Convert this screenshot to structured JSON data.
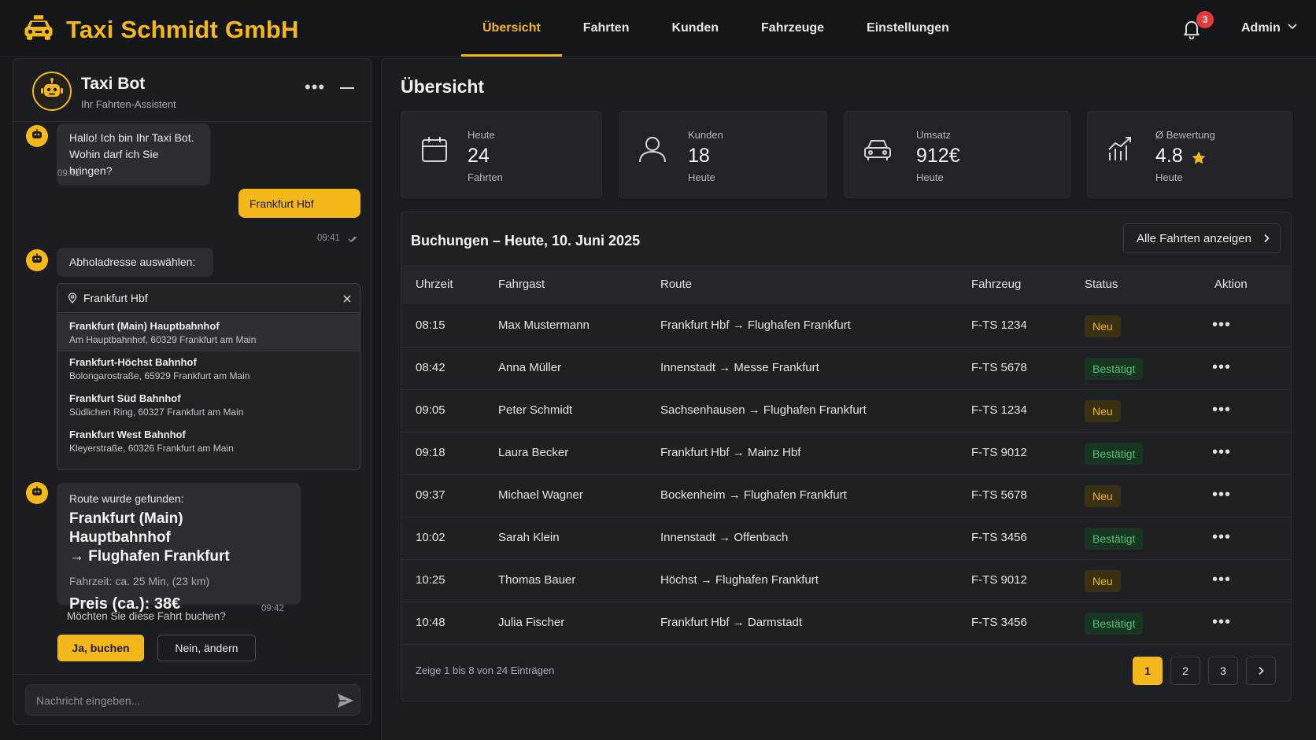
{
  "brand": {
    "name": "Taxi Schmidt GmbH",
    "accent_color": "#f5b81a"
  },
  "nav": {
    "items": [
      {
        "label": "Übersicht",
        "active": true
      },
      {
        "label": "Fahrten",
        "active": false
      },
      {
        "label": "Kunden",
        "active": false
      },
      {
        "label": "Fahrzeuge",
        "active": false
      },
      {
        "label": "Einstellungen",
        "active": false
      }
    ]
  },
  "header": {
    "notifications_count": "3",
    "user_label": "Admin"
  },
  "chat": {
    "title": "Taxi Bot",
    "subtitle": "Ihr Fahrten-Assistent",
    "messages": {
      "greeting_line1": "Hallo! Ich bin Ihr Taxi Bot.",
      "greeting_line2": "Wohin darf ich Sie bringen?",
      "greeting_time": "09:41",
      "user_msg": "Frankfurt Hbf",
      "user_time": "09:41",
      "pickup_prompt": "Abholadresse auswählen:"
    },
    "address_search": {
      "value": "Frankfurt Hbf",
      "options": [
        {
          "title": "Frankfurt (Main) Hauptbahnhof",
          "subtitle": "Am Hauptbahnhof, 60329 Frankfurt am Main",
          "selected": true
        },
        {
          "title": "Frankfurt-Höchst Bahnhof",
          "subtitle": "Bolongarostraße, 65929 Frankfurt am Main",
          "selected": false
        },
        {
          "title": "Frankfurt Süd Bahnhof",
          "subtitle": "Südlichen Ring, 60327 Frankfurt am Main",
          "selected": false
        },
        {
          "title": "Frankfurt West Bahnhof",
          "subtitle": "Kleyerstraße, 60326 Frankfurt am Main",
          "selected": false
        }
      ]
    },
    "route": {
      "label": "Route wurde gefunden:",
      "line1": "Frankfurt (Main) Hauptbahnhof",
      "line2": "→ Flughafen Frankfurt",
      "duration": "Fahrzeit: ca. 25 Min, (23 km)",
      "price": "Preis (ca.):  38€",
      "time": "09:42"
    },
    "question": "Möchten Sie diese Fahrt buchen?",
    "yes_label": "Ja, buchen",
    "no_label": "Nein, ändern",
    "input_placeholder": "Nachricht eingeben..."
  },
  "overview": {
    "title": "Übersicht",
    "kpis": [
      {
        "label": "Heute",
        "value": "24",
        "sub": "Fahrten",
        "icon": "calendar-icon"
      },
      {
        "label": "Kunden",
        "value": "18",
        "sub": "Heute",
        "icon": "user-icon"
      },
      {
        "label": "Umsatz",
        "value": "912€",
        "sub": "Heute",
        "icon": "car-icon"
      },
      {
        "label": "Ø Bewertung",
        "value": "4.8",
        "sub": "Heute",
        "icon": "chart-icon"
      }
    ]
  },
  "bookings": {
    "title": "Buchungen – Heute, 10. Juni 2025",
    "all_button": "Alle Fahrten anzeigen",
    "columns": [
      "Uhrzeit",
      "Fahrgast",
      "Route",
      "Fahrzeug",
      "Status",
      "Aktion"
    ],
    "rows": [
      {
        "time": "08:15",
        "guest": "Max Mustermann",
        "route": "Frankfurt Hbf → Flughafen Frankfurt",
        "vehicle": "F-TS 1234",
        "status": "Neu"
      },
      {
        "time": "08:42",
        "guest": "Anna Müller",
        "route": "Innenstadt → Messe Frankfurt",
        "vehicle": "F-TS 5678",
        "status": "Bestätigt"
      },
      {
        "time": "09:05",
        "guest": "Peter Schmidt",
        "route": "Sachsenhausen → Flughafen Frankfurt",
        "vehicle": "F-TS 1234",
        "status": "Neu"
      },
      {
        "time": "09:18",
        "guest": "Laura Becker",
        "route": "Frankfurt Hbf → Mainz Hbf",
        "vehicle": "F-TS 9012",
        "status": "Bestätigt"
      },
      {
        "time": "09:37",
        "guest": "Michael Wagner",
        "route": "Bockenheim → Flughafen Frankfurt",
        "vehicle": "F-TS 5678",
        "status": "Neu"
      },
      {
        "time": "10:02",
        "guest": "Sarah Klein",
        "route": "Innenstadt → Offenbach",
        "vehicle": "F-TS 3456",
        "status": "Bestätigt"
      },
      {
        "time": "10:25",
        "guest": "Thomas Bauer",
        "route": "Höchst → Flughafen Frankfurt",
        "vehicle": "F-TS 9012",
        "status": "Neu"
      },
      {
        "time": "10:48",
        "guest": "Julia Fischer",
        "route": "Frankfurt Hbf → Darmstadt",
        "vehicle": "F-TS 3456",
        "status": "Bestätigt"
      }
    ],
    "info": "Zeige 1 bis 8 von 24 Einträgen",
    "pages": [
      "1",
      "2",
      "3"
    ],
    "current_page": "1"
  }
}
